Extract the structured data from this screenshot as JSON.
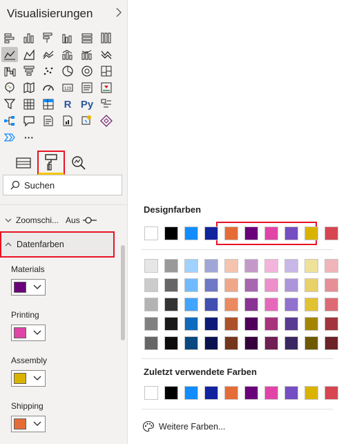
{
  "pane": {
    "title": "Visualisierungen",
    "visual_icons": [
      "stacked-bar-icon",
      "stacked-column-icon",
      "clustered-bar-icon",
      "clustered-column-icon",
      "100-bar-icon",
      "100-column-icon",
      "line-chart-icon",
      "area-chart-icon",
      "stacked-area-icon",
      "line-column-icon",
      "line-stacked-column-icon",
      "ribbon-chart-icon",
      "waterfall-icon",
      "funnel-icon",
      "scatter-icon",
      "pie-icon",
      "donut-icon",
      "treemap-icon",
      "map-icon",
      "filled-map-icon",
      "gauge-icon",
      "card-icon",
      "multirow-card-icon",
      "kpi-icon",
      "slicer-icon",
      "table-icon",
      "matrix-icon",
      "r-visual-icon",
      "python-visual-icon",
      "key-influencers-icon",
      "decomposition-tree-icon",
      "qa-icon",
      "narrative-icon",
      "paginated-icon",
      "power-apps-icon",
      "power-automate-icon",
      "more-visuals-icon",
      "ellipsis-icon"
    ],
    "r_label": "R",
    "py_label": "Py",
    "more_label": "···",
    "tools": [
      "fields-icon",
      "format-paint-icon",
      "analytics-icon"
    ],
    "search_placeholder": "Suchen",
    "zoom_label": "Zoomschi...",
    "zoom_state": "Aus",
    "section_label": "Datenfarben",
    "properties": [
      {
        "label": "Materials",
        "color": "#6b007b"
      },
      {
        "label": "Printing",
        "color": "#e044a7"
      },
      {
        "label": "Assembly",
        "color": "#d9b300"
      },
      {
        "label": "Shipping",
        "color": "#e66c37"
      }
    ]
  },
  "picker": {
    "theme_title": "Designfarben",
    "theme_colors": [
      "#ffffff",
      "#000000",
      "#118dff",
      "#12239e",
      "#e66c37",
      "#6b007b",
      "#e044a7",
      "#744ec2",
      "#d9b300",
      "#d64550"
    ],
    "shades": [
      [
        "#e6e6e6",
        "#999999",
        "#a0d1ff",
        "#a0a7d8",
        "#f5c4af",
        "#c499ca",
        "#f3b4dc",
        "#c7b8e7",
        "#f0e199",
        "#efb5b9"
      ],
      [
        "#cccccc",
        "#666666",
        "#70bbff",
        "#7079c5",
        "#f0a787",
        "#a766b0",
        "#ec8fca",
        "#ac95da",
        "#e8d166",
        "#e68f96"
      ],
      [
        "#b3b3b3",
        "#333333",
        "#41a4ff",
        "#414fb1",
        "#eb895f",
        "#893395",
        "#e669b9",
        "#9071ce",
        "#e1c233",
        "#de6a73"
      ],
      [
        "#808080",
        "#1a1a1a",
        "#0d6abf",
        "#0e1a77",
        "#ad5129",
        "#50005c",
        "#a8337d",
        "#573b92",
        "#a38600",
        "#a1343c"
      ],
      [
        "#666666",
        "#0d0d0d",
        "#094780",
        "#09124f",
        "#73361c",
        "#36003e",
        "#701f53",
        "#3a2761",
        "#6d5a00",
        "#6b2328"
      ]
    ],
    "recent_title": "Zuletzt verwendete Farben",
    "recent_colors": [
      "#ffffff",
      "#000000",
      "#118dff",
      "#12239e",
      "#e66c37",
      "#6b007b",
      "#e044a7",
      "#744ec2",
      "#d9b300",
      "#d64550"
    ],
    "more_colors_label": "Weitere Farben..."
  }
}
